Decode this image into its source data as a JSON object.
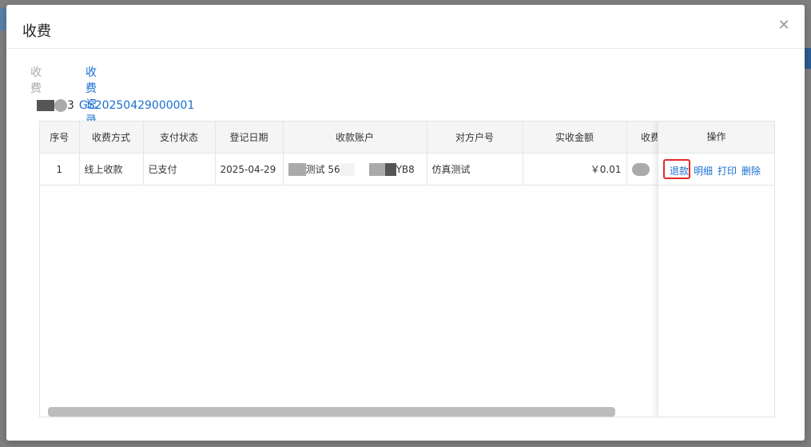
{
  "modal": {
    "title": "收费"
  },
  "tabs": [
    {
      "label": "收费"
    },
    {
      "label": "收费记录"
    }
  ],
  "reference": {
    "prefix_visible": "3",
    "number": "GS20250429000001"
  },
  "table": {
    "columns": [
      "序号",
      "收费方式",
      "支付状态",
      "登记日期",
      "收款账户",
      "对方户号",
      "实收金额",
      "收费",
      "操作"
    ],
    "rows": [
      {
        "index": "1",
        "method": "线上收款",
        "status": "已支付",
        "date": "2025-04-29",
        "account_part1": "测试 56",
        "account_part2": "YB8",
        "counterparty": "仿真测试",
        "amount": "￥0.01"
      }
    ],
    "actions": [
      "退款",
      "明细",
      "打印",
      "删除"
    ]
  },
  "colors": {
    "link": "#1a6fd1",
    "highlight": "#e02a2a"
  }
}
